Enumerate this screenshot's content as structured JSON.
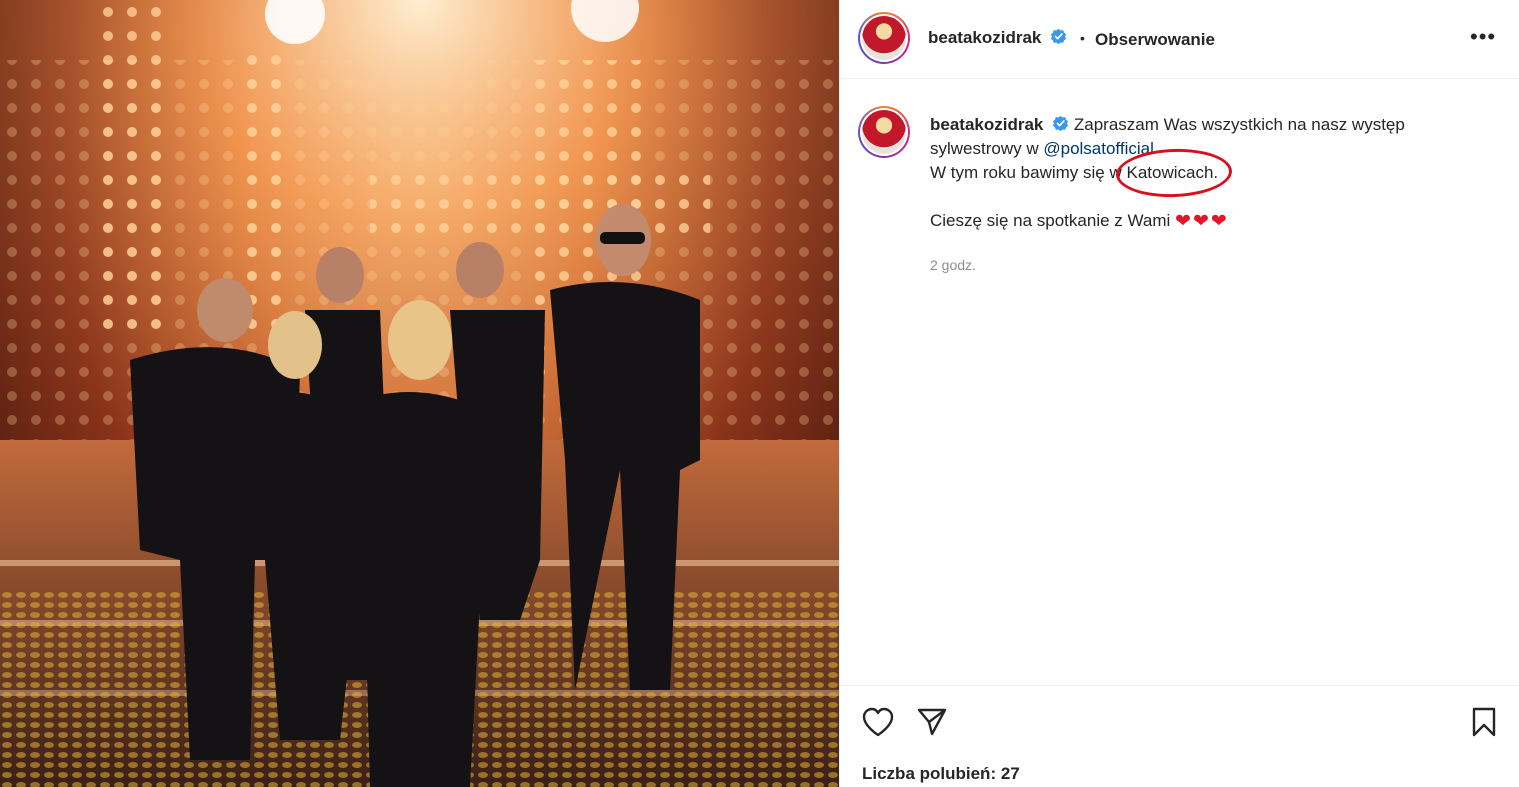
{
  "post": {
    "photo_alt": "Zespół na scenie",
    "author": "beatakozidrak",
    "follow_status": "Obserwowanie",
    "dot": "•",
    "more": "•••",
    "caption": {
      "username": "beatakozidrak",
      "line1": "Zapraszam Was wszystkich na nasz występ sylwestrowy w ",
      "mention": "@polsatofficial",
      "line2_prefix": "W tym roku bawimy się w ",
      "city": "Katowicach.",
      "line3": "Cieszę się na spotkanie z Wami ",
      "hearts": "❤❤❤"
    },
    "time": "2 godz.",
    "likes": "Liczba polubień: 27"
  },
  "colors": {
    "verified": "#3897f0",
    "annotation": "#d80f1f",
    "mention": "#00376b",
    "muted": "#8e8e8e"
  },
  "icons": {
    "like": "heart-icon",
    "share": "paper-plane-icon",
    "save": "bookmark-icon",
    "more": "more-options-icon"
  }
}
